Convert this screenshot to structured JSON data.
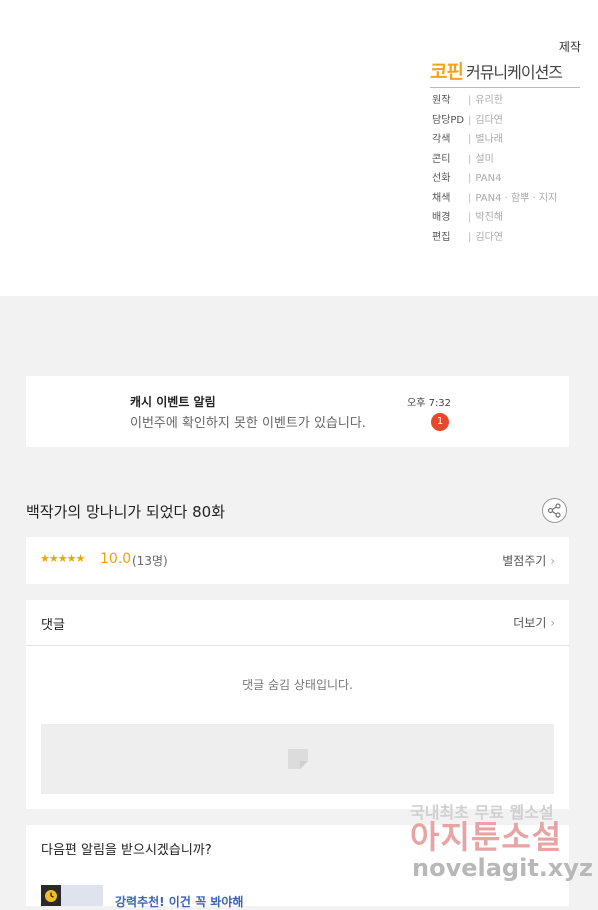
{
  "credits": {
    "production_label": "제작",
    "company": {
      "highlight": "코핀",
      "rest": "커뮤니케이션즈"
    },
    "rows": [
      {
        "role": "원작",
        "names": "유리한"
      },
      {
        "role": "담당PD",
        "names": "김다연"
      },
      {
        "role": "각색",
        "names": "별나래"
      },
      {
        "role": "콘티",
        "names": "설미"
      },
      {
        "role": "선화",
        "names": "PAN4"
      },
      {
        "role": "채색",
        "names": "PAN4 · 함뿌 · 지지"
      },
      {
        "role": "배경",
        "names": "박진해"
      },
      {
        "role": "편집",
        "names": "김다연"
      }
    ]
  },
  "notification": {
    "title": "캐시 이벤트 알림",
    "body": "이번주에 확인하지 못한 이벤트가 있습니다.",
    "time": "오후 7:32",
    "badge": "1"
  },
  "episode": {
    "title": "백작가의 망나니가 되었다 80화"
  },
  "rating": {
    "stars": "★★★★★",
    "score": "10.0",
    "count": "(13명)",
    "rate_link": "별점주기"
  },
  "comments": {
    "title": "댓글",
    "more": "더보기",
    "hidden_msg": "댓글 숨김 상태입니다."
  },
  "next_episode": {
    "prompt": "다음편 알림을 받으시겠습니까?",
    "promo": "강력추천! 이건 꼭 봐야해"
  },
  "watermark": {
    "line1": "국내최초 무료 웹소설",
    "line2": "아지툰소설",
    "line3": "novelagit.xyz"
  },
  "icons": {
    "share": "share-icon",
    "chevron": "chevron-right-icon",
    "clock": "clock-icon",
    "placeholder": "image-placeholder-icon"
  },
  "colors": {
    "accent": "#f0a500",
    "badge": "#e8472a",
    "link": "#3a64b8"
  }
}
